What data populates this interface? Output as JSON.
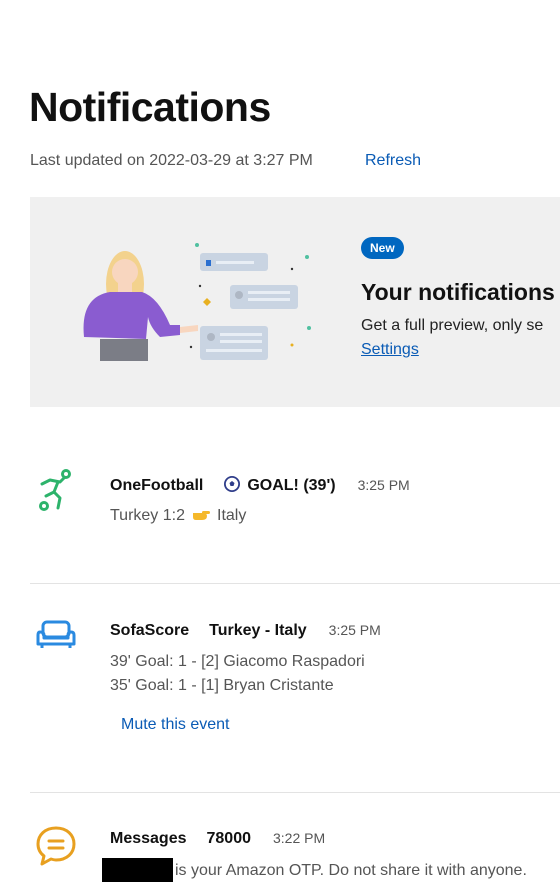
{
  "page": {
    "title": "Notifications",
    "last_updated": "Last updated on 2022-03-29 at 3:27 PM",
    "refresh_label": "Refresh"
  },
  "banner": {
    "badge": "New",
    "title": "Your notifications",
    "description": "Get a full preview, only se",
    "link": "Settings"
  },
  "notifications": [
    {
      "app": "OneFootball",
      "subject": "GOAL! (39')",
      "time": "3:25 PM",
      "lines": [
        "Turkey 1:2",
        "Italy"
      ],
      "icon": "soccer-player-icon",
      "icon_color": "#2db36b"
    },
    {
      "app": "SofaScore",
      "subject": "Turkey - Italy",
      "time": "3:25 PM",
      "lines": [
        "39' Goal: 1 - [2] Giacomo Raspadori",
        "35' Goal: 1 - [1] Bryan Cristante"
      ],
      "action": "Mute this event",
      "icon": "sofa-icon",
      "icon_color": "#2a8ae0"
    },
    {
      "app": "Messages",
      "subject": "78000",
      "time": "3:22 PM",
      "lines": [
        "is your Amazon OTP. Do not share it with anyone."
      ],
      "icon": "chat-bubble-icon",
      "icon_color": "#e8a020"
    }
  ]
}
